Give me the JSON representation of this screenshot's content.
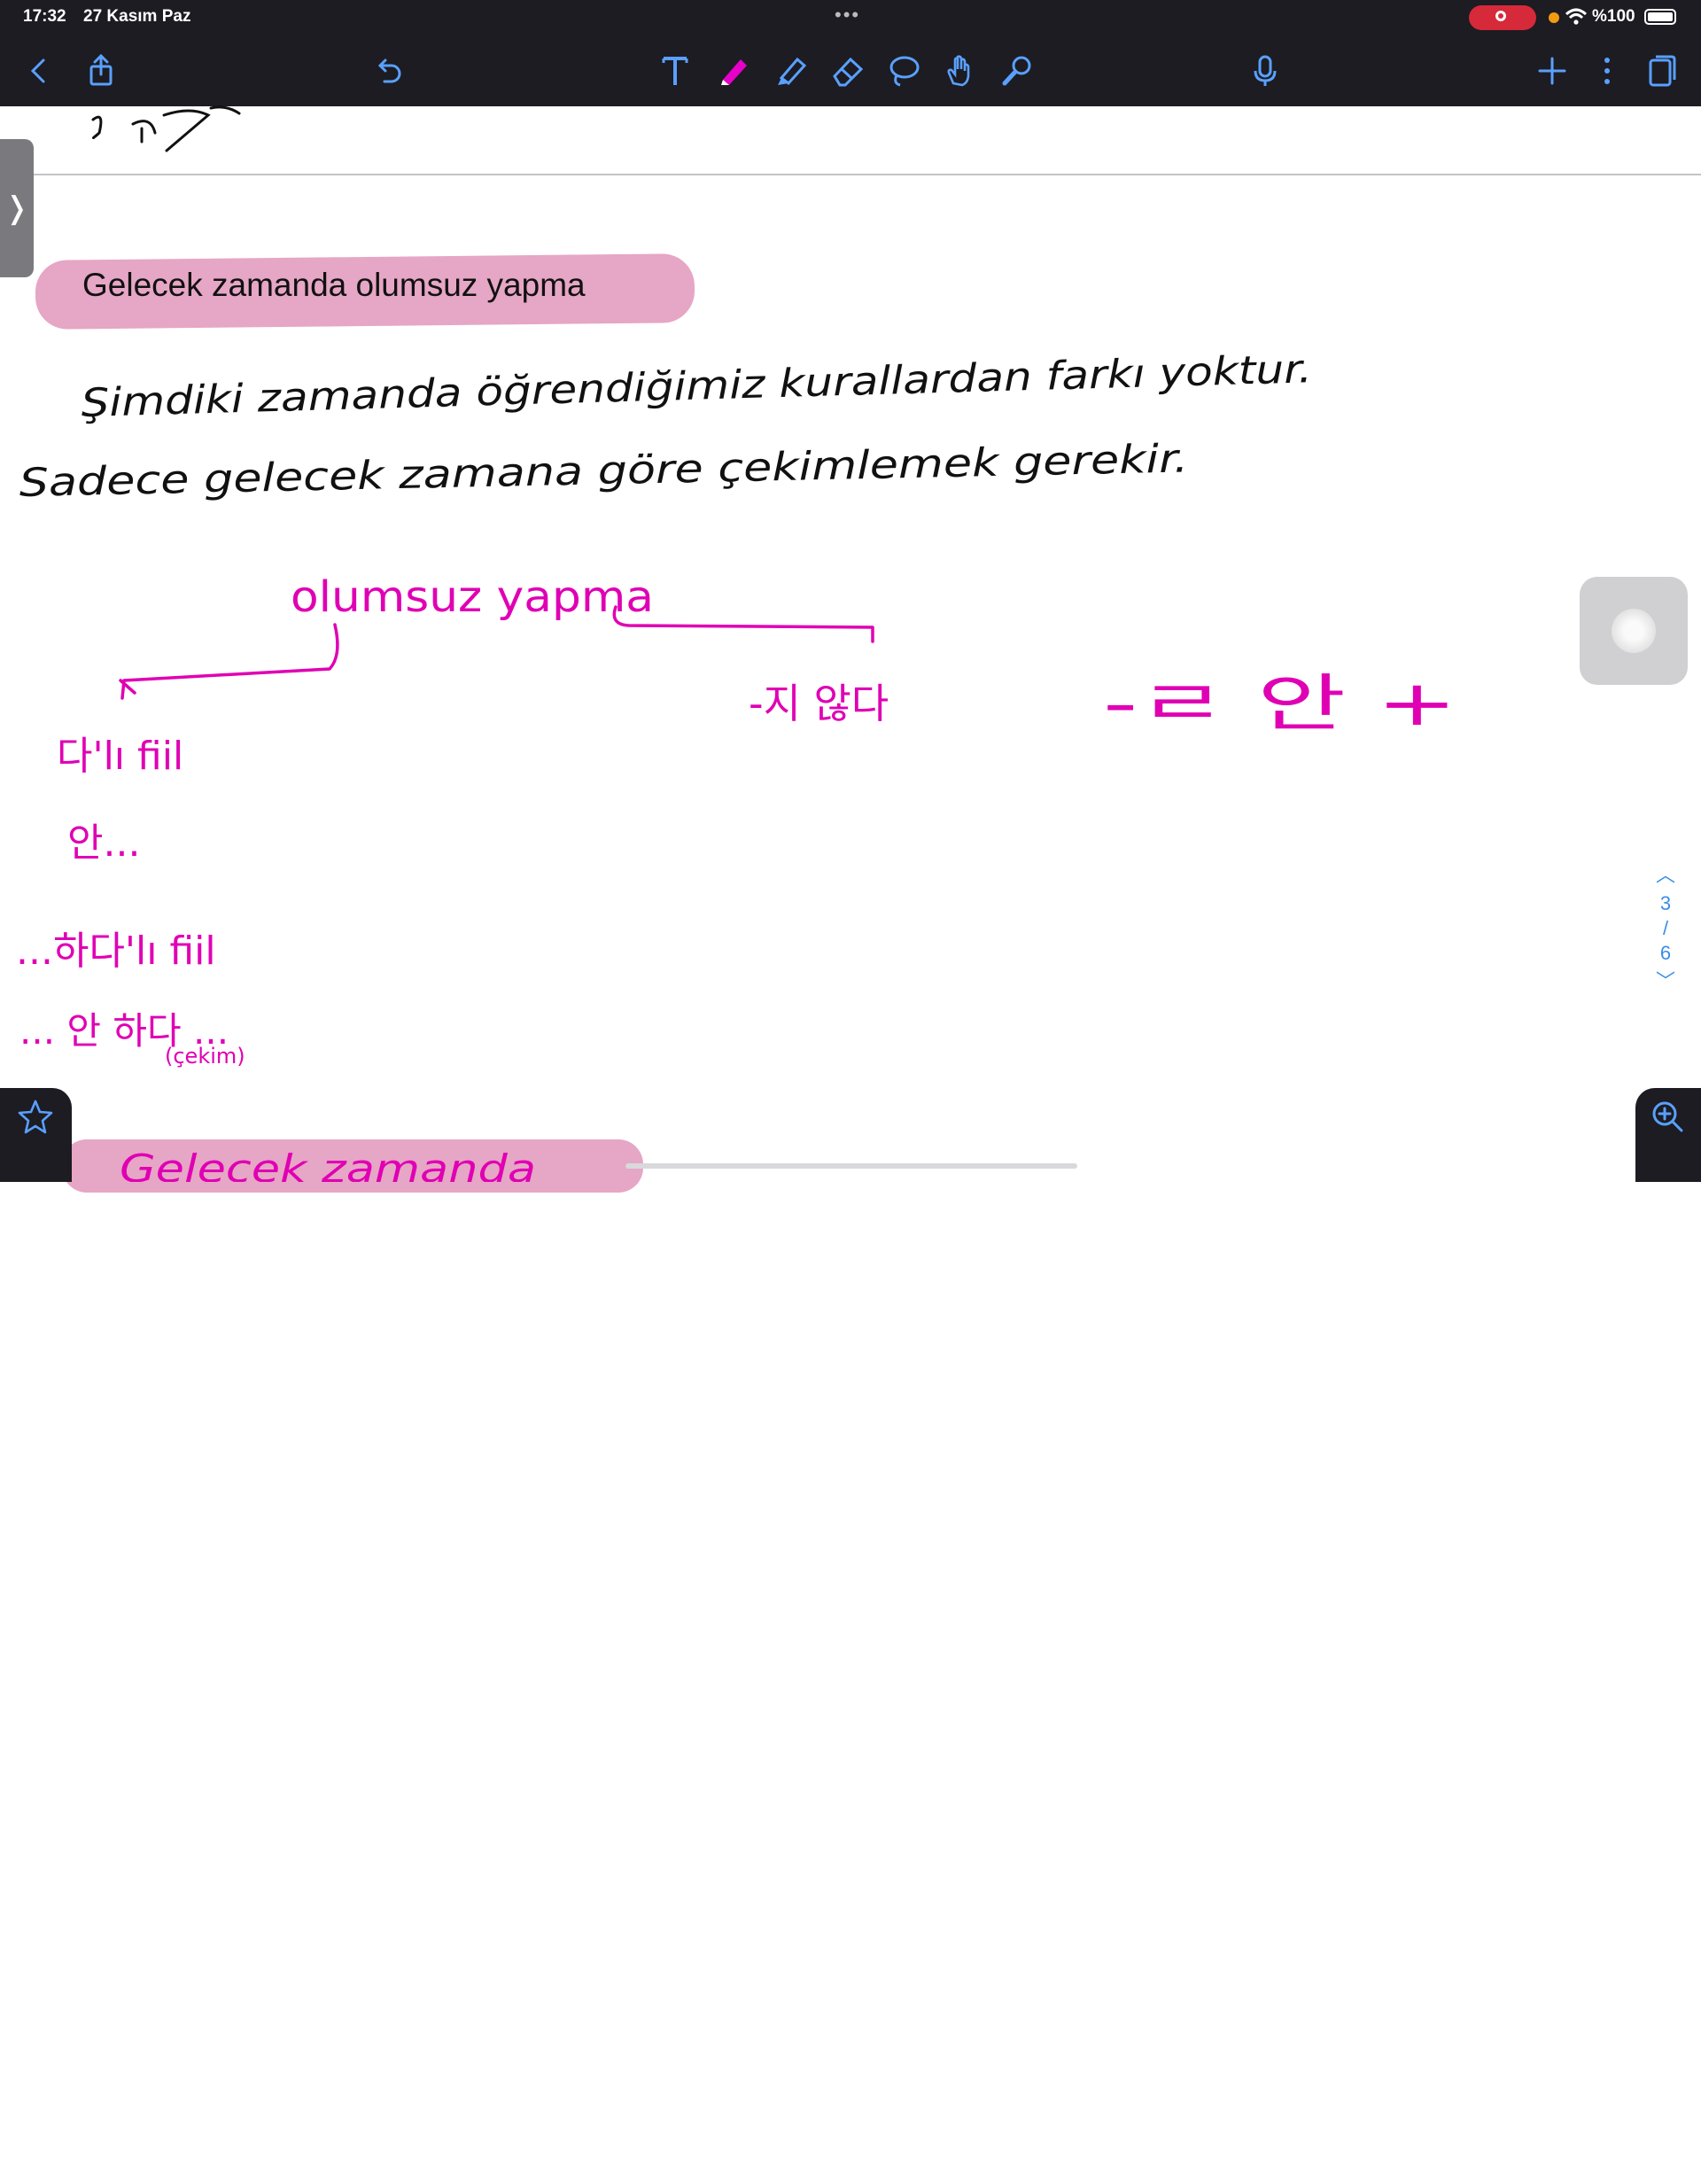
{
  "status_bar": {
    "time": "17:32",
    "date": "27 Kasım Paz",
    "battery": "%100"
  },
  "toolbar": {
    "icons": [
      "back-icon",
      "share-icon",
      "undo-icon",
      "text-tool-icon",
      "pen-icon",
      "highlighter-icon",
      "eraser-icon",
      "lasso-icon",
      "hand-icon",
      "laser-pointer-icon",
      "microphone-icon",
      "add-page-icon",
      "more-icon",
      "pages-icon"
    ],
    "accent_color": "#e600c8",
    "icon_color": "#5aa0ff"
  },
  "note": {
    "heading": "Gelecek zamanda olumsuz yapma",
    "handwriting_color": "#e000b4",
    "line1": "Şimdiki zamanda öğrendiğimiz kurallardan farkı yoktur.",
    "line2": "Sadece gelecek zamana göre çekimlemek gerekir.",
    "diagram_title": "olumsuz yapma",
    "branch_right": "-지 않다",
    "branch_far_right": "-ㄹ 안 +",
    "item1": "다'lı fiil",
    "item2": "안...",
    "item3": "...하다'lı fiil",
    "item4": "... 안 하다 ...",
    "item4_note": "(çekim)",
    "next_heading": "Gelecek zamanda"
  },
  "pager": {
    "current": "3",
    "separator": "/",
    "total": "6"
  }
}
